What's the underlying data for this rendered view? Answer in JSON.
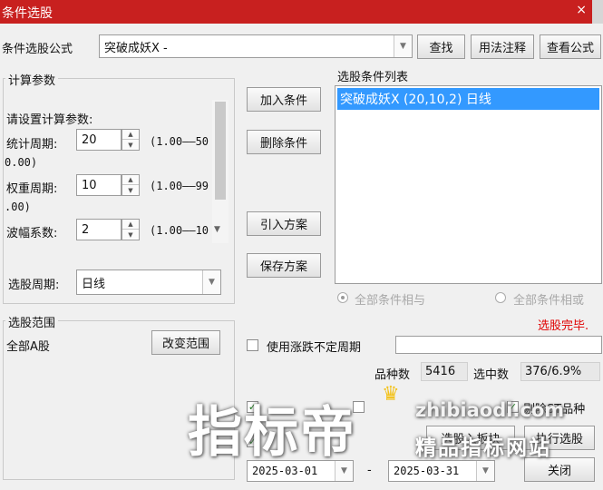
{
  "window": {
    "title": "条件选股",
    "close_glyph": "×"
  },
  "formula": {
    "label": "条件选股公式",
    "value": "突破成妖X  -",
    "btn_find": "查找",
    "btn_usage": "用法注释",
    "btn_view": "查看公式"
  },
  "params": {
    "group_title": "计算参数",
    "prompt": "请设置计算参数:",
    "rows": [
      {
        "label": "统计周期:",
        "value": "20",
        "range1": "(1.00——50",
        "range2": "0.00)"
      },
      {
        "label": "权重周期:",
        "value": "10",
        "range1": "(1.00——99",
        "range2": ".00)"
      },
      {
        "label": "波幅系数:",
        "value": "2",
        "range1": "(1.00——10"
      }
    ],
    "period_label": "选股周期:",
    "period_value": "日线"
  },
  "actions": {
    "add": "加入条件",
    "delete": "删除条件",
    "import": "引入方案",
    "save": "保存方案"
  },
  "condition_list": {
    "title": "选股条件列表",
    "items": [
      "突破成妖X (20,10,2) 日线"
    ]
  },
  "logic": {
    "all_and": "全部条件相与",
    "all_or": "全部条件相或"
  },
  "status": {
    "text": "选股完毕.",
    "color": "#e00000"
  },
  "scope": {
    "group_title": "选股范围",
    "value": "全部A股",
    "change_btn": "改变范围"
  },
  "undetermined": {
    "label": "使用涨跌不定周期",
    "value": ""
  },
  "stats": {
    "count_label": "品种数",
    "count_value": "5416",
    "selected_label": "选中数",
    "selected_value": "376/6.9%"
  },
  "options": {
    "exclude_st": "剔除ST品种"
  },
  "bottom": {
    "to_block": "选股入板块",
    "run": "执行选股",
    "close": "关闭",
    "date_from": "2025-03-01",
    "date_sep": "-",
    "date_to": "2025-03-31"
  },
  "watermark": {
    "big": "指标帝",
    "url": "zhibiaodi.com",
    "slogan": "精品指标网站"
  },
  "colors": {
    "title_bar": "#c8201f",
    "selection": "#3399ff",
    "accent_red": "#e00000"
  }
}
